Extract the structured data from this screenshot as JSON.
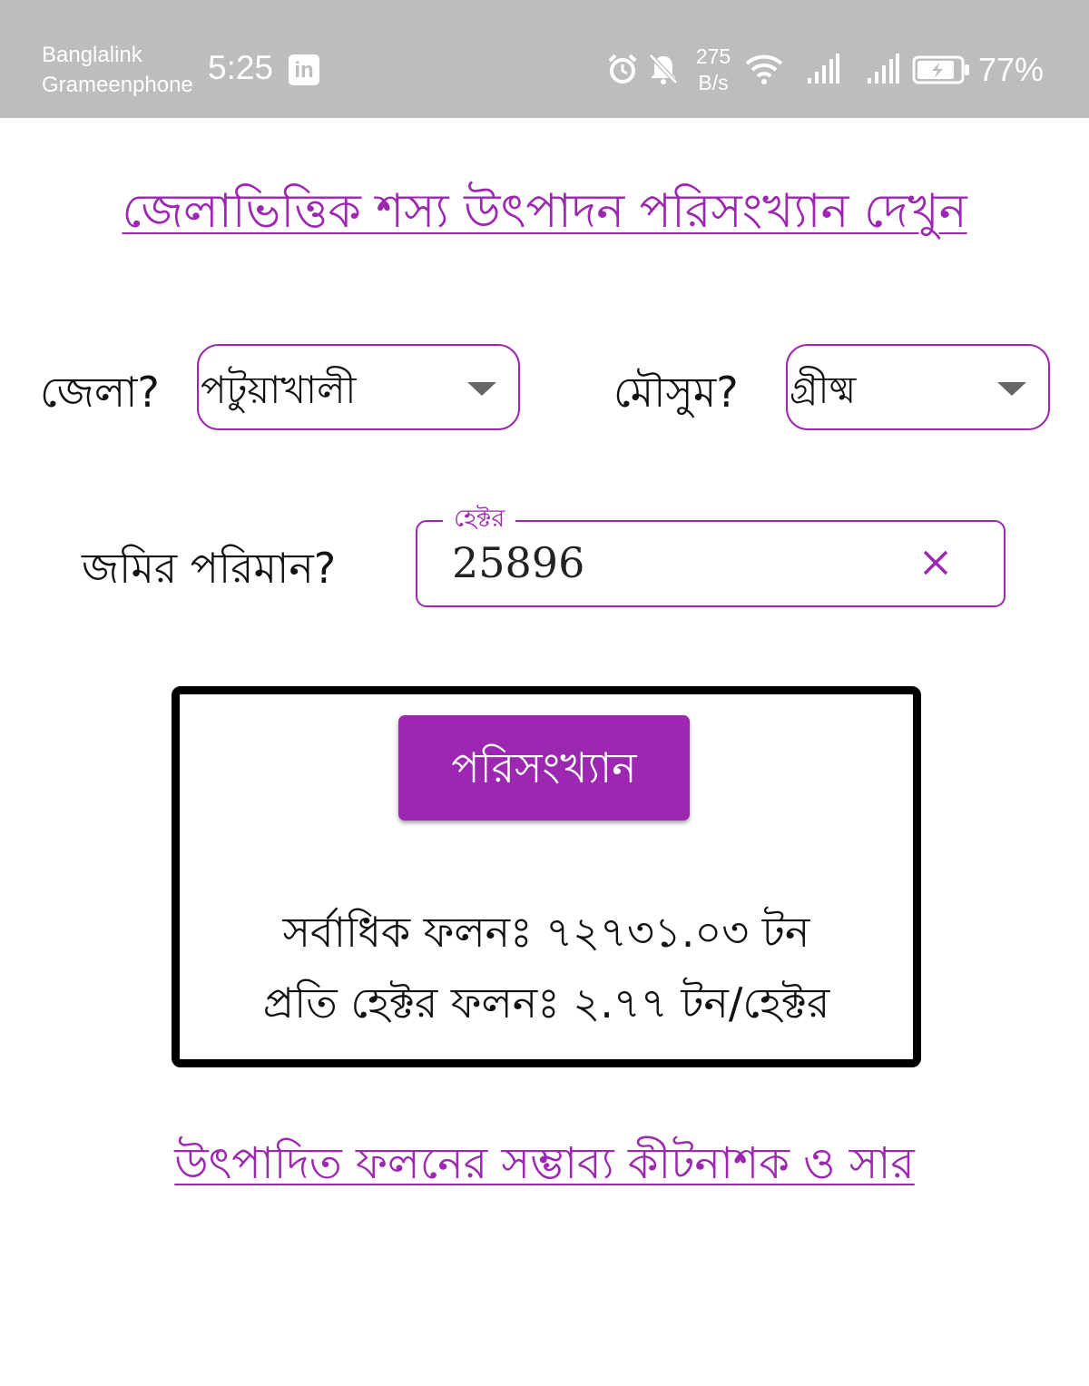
{
  "status_bar": {
    "carrier1": "Banglalink",
    "carrier2": "Grameenphone",
    "time": "5:25",
    "app_icon": "linkedin-icon",
    "net_speed_value": "275",
    "net_speed_unit": "B/s",
    "battery": "77%",
    "icons": [
      "alarm-icon",
      "bell-off-icon",
      "wifi-icon",
      "signal-icon",
      "signal-icon",
      "battery-charging-icon"
    ]
  },
  "header": {
    "title_link": "জেলাভিত্তিক শস্য উৎপাদন পরিসংখ্যান দেখুন"
  },
  "form": {
    "district_label": "জেলা?",
    "district_value": "পটুয়াখালী",
    "season_label": "মৌসুম?",
    "season_value": "গ্রীষ্ম",
    "land_label": "জমির পরিমান?",
    "land_field_label": "হেক্টর",
    "land_value": "25896"
  },
  "result": {
    "button_label": "পরিসংখ্যান",
    "max_yield": "সর্বাধিক ফলনঃ ৭২৭৩১.০৩ টন",
    "per_hectare": "প্রতি হেক্টর ফলনঃ ২.৭৭ টন/হেক্টর"
  },
  "footer": {
    "link": "উৎপাদিত ফলনের সম্ভাব্য কীটনাশক ও সার"
  },
  "colors": {
    "accent": "#9c27b0",
    "status_bar": "#bdbdbd"
  }
}
